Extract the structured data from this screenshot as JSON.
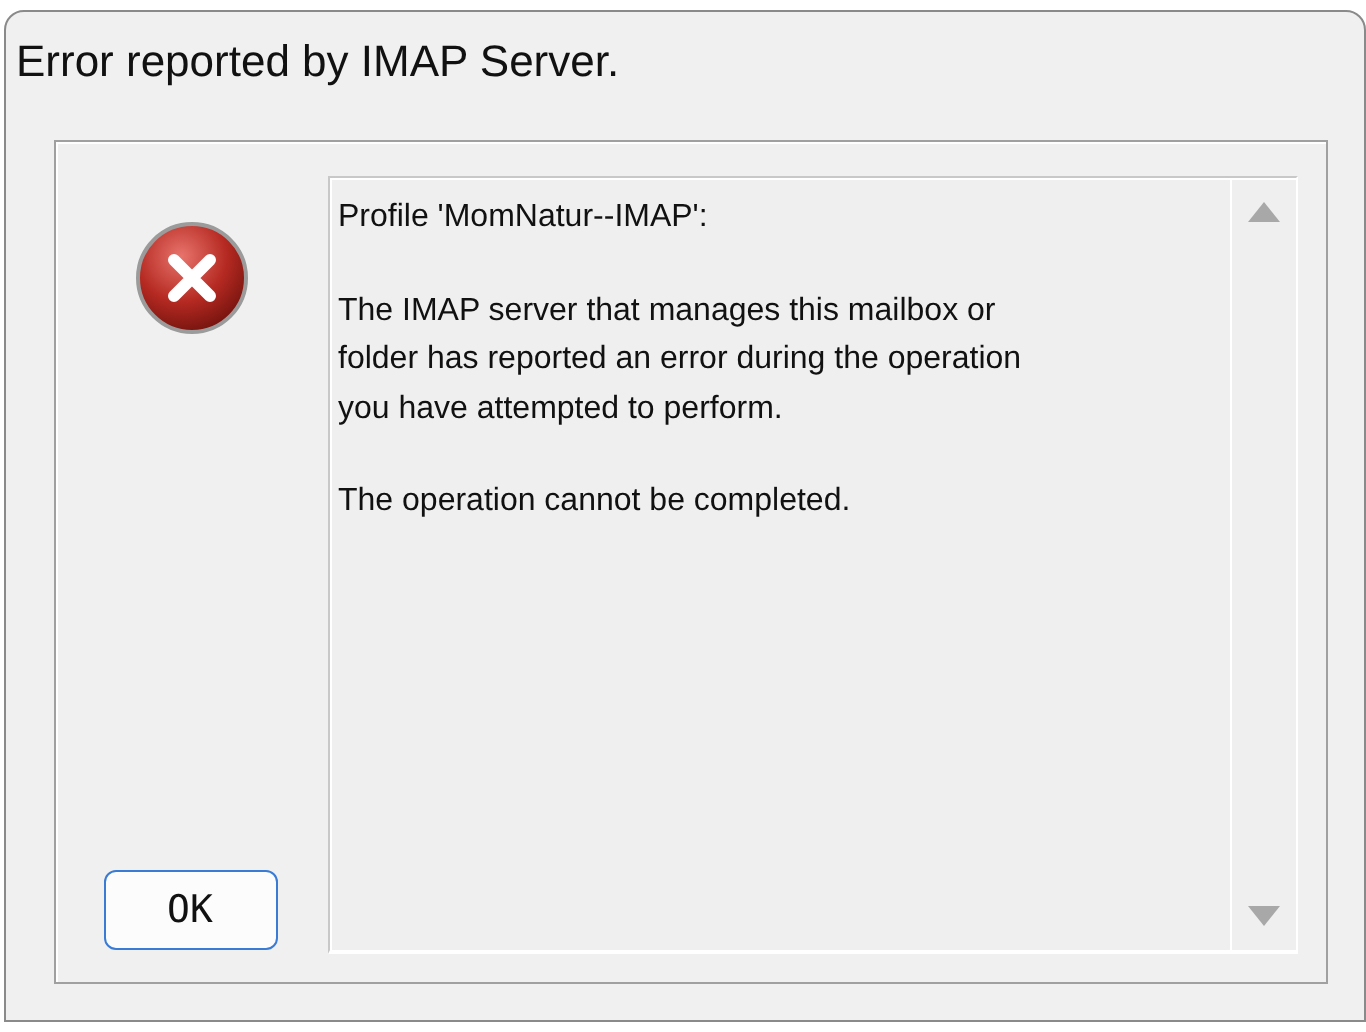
{
  "window": {
    "title": "Error reported by IMAP Server."
  },
  "message": {
    "paragraphs": [
      "Profile 'MomNatur--IMAP':",
      "The IMAP server that manages this mailbox or\nfolder has reported an error during the operation\nyou have attempted to perform.",
      "The operation cannot be completed."
    ]
  },
  "buttons": [
    {
      "label": "OK",
      "focused": true
    }
  ]
}
